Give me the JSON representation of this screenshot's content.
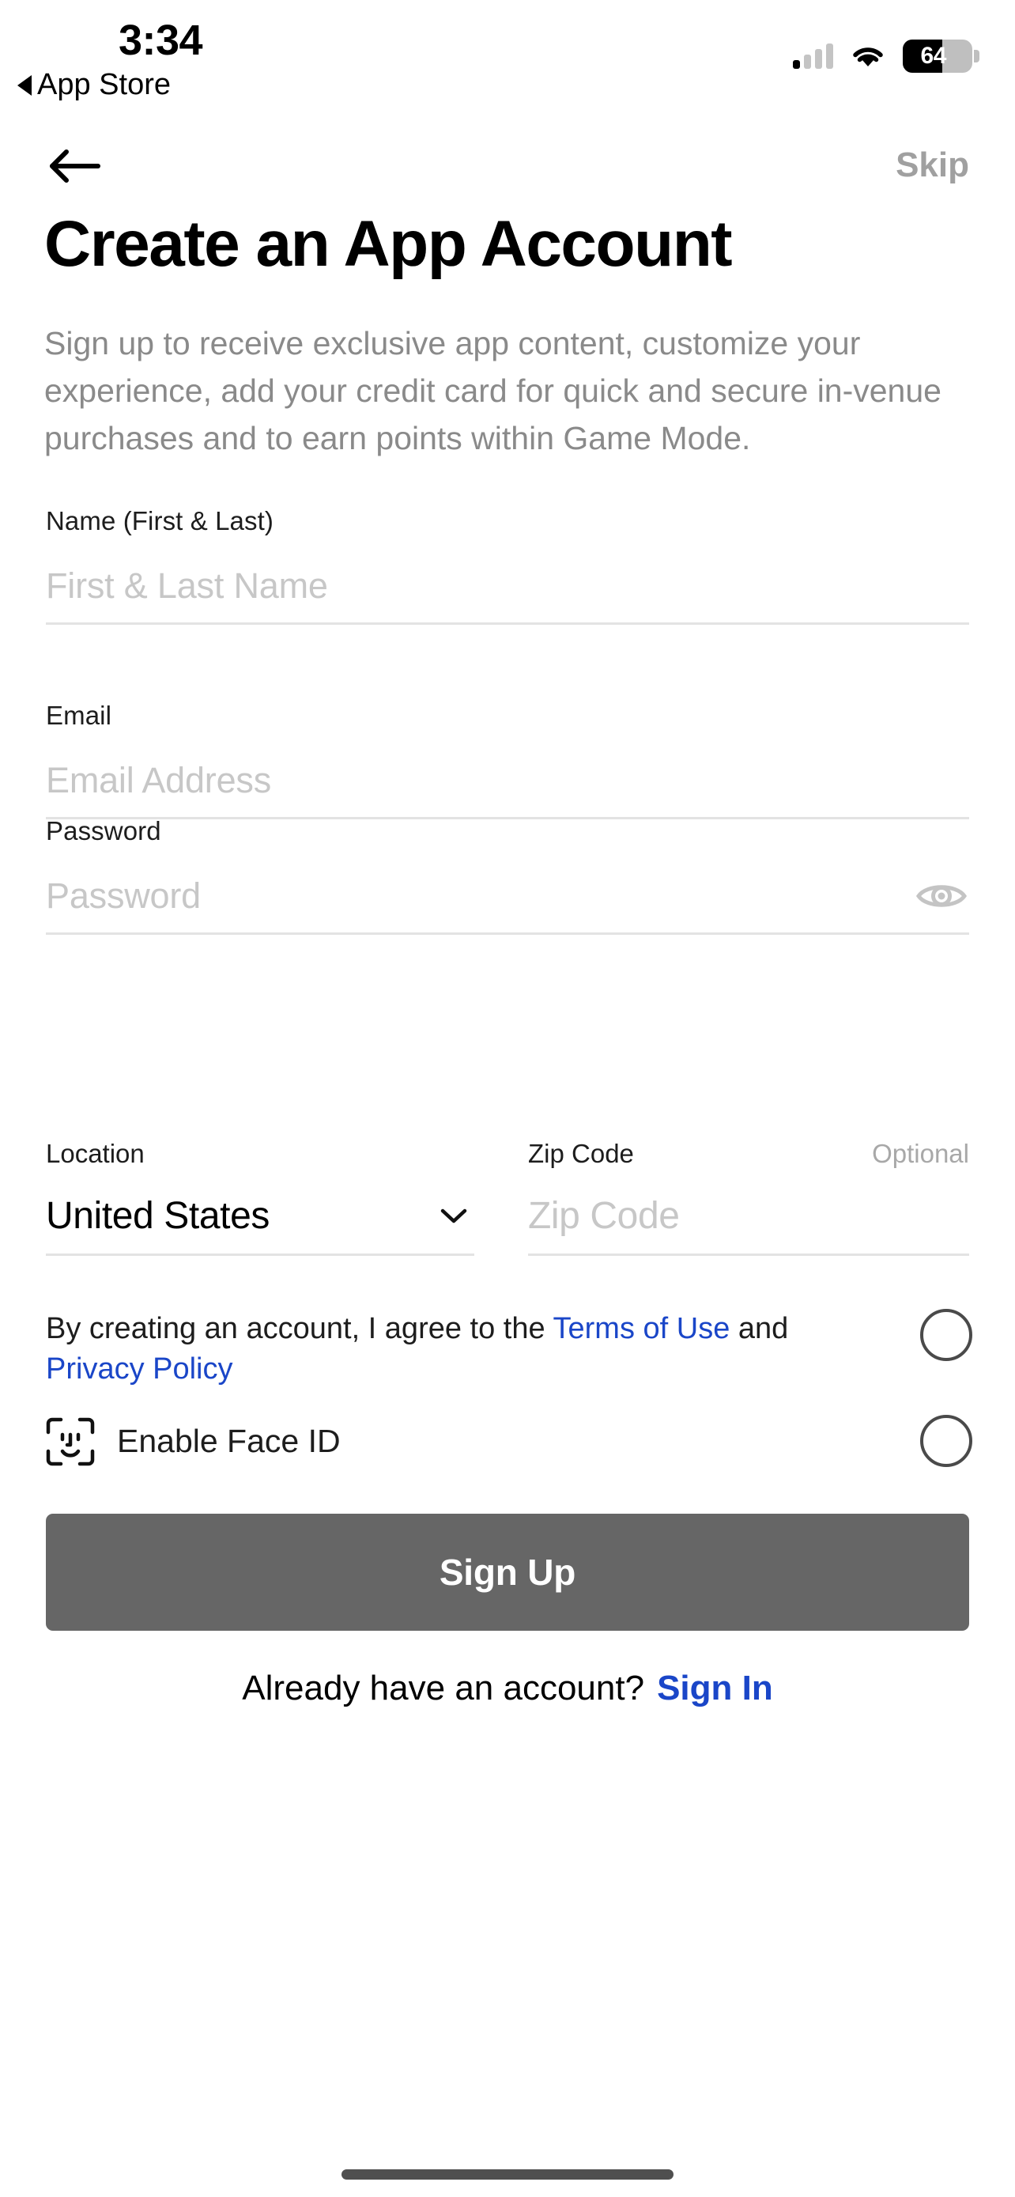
{
  "status_bar": {
    "time": "3:34",
    "back_to_app": "App Store",
    "battery_percent": "64",
    "battery_level": 64,
    "signal_bars_filled": 1,
    "signal_bars_total": 4,
    "icons": [
      "back-triangle-icon",
      "cellular-signal-icon",
      "wifi-icon",
      "battery-icon"
    ]
  },
  "navbar": {
    "back_label": "Back",
    "skip_label": "Skip"
  },
  "page": {
    "title": "Create an App Account",
    "description": "Sign up to receive exclusive app content, customize your experience, add your credit card for quick and secure in-venue purchases and to earn points within Game Mode."
  },
  "form": {
    "name": {
      "label": "Name (First & Last)",
      "placeholder": "First & Last Name",
      "value": ""
    },
    "email": {
      "label": "Email",
      "placeholder": "Email Address",
      "value": ""
    },
    "password": {
      "label": "Password",
      "placeholder": "Password",
      "value": "",
      "toggle_icon": "eye-icon"
    },
    "location": {
      "label": "Location",
      "value": "United States",
      "chevron_icon": "chevron-down-icon"
    },
    "zip": {
      "label": "Zip Code",
      "optional_label": "Optional",
      "placeholder": "Zip Code",
      "value": ""
    }
  },
  "consent": {
    "terms_prefix": "By creating an account, I agree to the ",
    "terms_link": "Terms of Use",
    "terms_middle": " and ",
    "privacy_link": "Privacy Policy",
    "terms_checked": false,
    "faceid_label": "Enable Face ID",
    "faceid_icon": "face-id-icon",
    "faceid_checked": false
  },
  "actions": {
    "signup_label": "Sign Up",
    "signup_enabled": false,
    "footer_question": "Already have an account?",
    "signin_label": "Sign In"
  },
  "colors": {
    "link_blue": "#1a46c8",
    "button_gray": "#666666",
    "placeholder_gray": "#c7c7c7",
    "label_dark": "#1d1d1d",
    "description_gray": "#8a8a8a",
    "skip_gray": "#a0a0a0",
    "underline_gray": "#e3e3e3"
  }
}
